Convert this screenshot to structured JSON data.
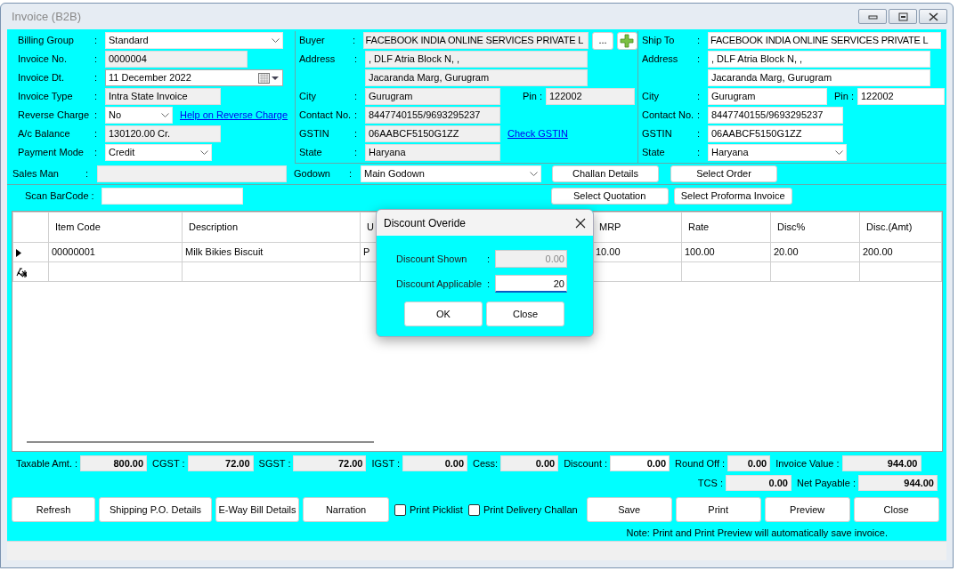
{
  "window": {
    "title": "Invoice (B2B)"
  },
  "invoice": [
    {
      "label": "Billing Group",
      "sep": ":",
      "kind": "select",
      "value": "Standard"
    },
    {
      "label": "Invoice No.",
      "sep": ":",
      "kind": "readonly",
      "value": "0000004"
    },
    {
      "label": "Invoice Dt.",
      "sep": ":",
      "kind": "date",
      "value": "11 December 2022"
    },
    {
      "label": "Invoice Type",
      "sep": ":",
      "kind": "readonly",
      "value": "Intra State Invoice"
    },
    {
      "label": "Reverse Charge",
      "sep": ":",
      "kind": "select",
      "value": "No",
      "link": "Help on Reverse Charge"
    },
    {
      "label": "A/c Balance",
      "sep": ":",
      "kind": "readonly",
      "value": "130120.00 Cr."
    },
    {
      "label": "Payment Mode",
      "sep": ":",
      "kind": "select",
      "value": "Credit"
    }
  ],
  "buyer": [
    {
      "label": "Buyer",
      "sep": ":",
      "kind": "readonly",
      "value": "FACEBOOK INDIA ONLINE SERVICES PRIVATE L",
      "button": "...",
      "add_button": true
    },
    {
      "label": "Address",
      "sep": ":",
      "kind": "readonly",
      "value": ", DLF Atria Block N, ,"
    },
    {
      "kind": "readonly",
      "value": "Jacaranda Marg, Gurugram"
    },
    {
      "label": "City",
      "sep": ":",
      "kind": "readonly",
      "value": "Gurugram",
      "pin_label": "Pin :",
      "pin": "122002"
    },
    {
      "label": "Contact No.",
      "sep": ":",
      "kind": "readonly",
      "value": "8447740155/9693295237"
    },
    {
      "label": "GSTIN",
      "sep": ":",
      "kind": "readonly",
      "value": "06AABCF5150G1ZZ",
      "link": "Check GSTIN"
    },
    {
      "label": "State",
      "sep": ":",
      "kind": "readonly",
      "value": "Haryana"
    }
  ],
  "ship_to": [
    {
      "label": "Ship To",
      "sep": ":",
      "kind": "input",
      "value": "FACEBOOK INDIA ONLINE SERVICES PRIVATE L"
    },
    {
      "label": "Address",
      "sep": ":",
      "kind": "input",
      "value": ", DLF Atria Block N, ,"
    },
    {
      "kind": "input",
      "value": "Jacaranda Marg, Gurugram"
    },
    {
      "label": "City",
      "sep": ":",
      "kind": "input",
      "value": "Gurugram",
      "pin_label": "Pin :",
      "pin": "122002"
    },
    {
      "label": "Contact No.",
      "sep": ":",
      "kind": "input",
      "value": "8447740155/9693295237"
    },
    {
      "label": "GSTIN",
      "sep": ":",
      "kind": "input",
      "value": "06AABCF5150G1ZZ"
    },
    {
      "label": "State",
      "sep": ":",
      "kind": "select",
      "value": "Haryana"
    }
  ],
  "sales_man": {
    "label": "Sales Man",
    "sep": ":",
    "kind": "readonly"
  },
  "godown": {
    "label": "Godown",
    "sep": ":",
    "kind": "select",
    "value": "Main Godown"
  },
  "order_buttons": [
    "Challan Details",
    "Select Order"
  ],
  "scan_barcode": {
    "label": "Scan BarCode :",
    "kind": "input"
  },
  "quote_buttons": [
    "Select Quotation",
    "Select Proforma Invoice"
  ],
  "table": {
    "columns": [
      "Item Code",
      "Description",
      "U",
      "MRP",
      "Rate",
      "Disc%",
      "Disc.(Amt)"
    ],
    "rows": [
      {
        "kind": "current",
        "cells": [
          "00000001",
          "Milk Bikies Biscuit",
          "P",
          "10.00",
          "100.00",
          "20.00",
          "200.00"
        ]
      },
      {
        "kind": "new"
      }
    ]
  },
  "totals": [
    {
      "label": "Taxable Amt. :",
      "value": "800.00",
      "kind": "readonly"
    },
    {
      "label": "CGST :",
      "value": "72.00",
      "kind": "readonly"
    },
    {
      "label": "SGST :",
      "value": "72.00",
      "kind": "readonly"
    },
    {
      "label": "IGST :",
      "value": "0.00",
      "kind": "readonly"
    },
    {
      "label": "Cess:",
      "value": "0.00",
      "kind": "readonly"
    },
    {
      "label": "Discount :",
      "value": "0.00",
      "kind": "input"
    },
    {
      "label": "Round Off :",
      "value": "0.00",
      "kind": "readonly"
    },
    {
      "label": "Invoice Value :",
      "value": "944.00",
      "kind": "readonly"
    }
  ],
  "totals_2": [
    {
      "label": "TCS :",
      "value": "0.00",
      "kind": "readonly"
    },
    {
      "label": "Net Payable  :",
      "value": "944.00",
      "kind": "readonly"
    }
  ],
  "actions": [
    {
      "kind": "button",
      "label": "Refresh"
    },
    {
      "kind": "button",
      "label": "Shipping P.O. Details"
    },
    {
      "kind": "button",
      "label": "E-Way Bill Details"
    },
    {
      "kind": "button",
      "label": "Narration"
    },
    {
      "kind": "checkbox",
      "label": "Print Picklist",
      "checked": false
    },
    {
      "kind": "checkbox",
      "label": "Print Delivery Challan",
      "checked": false
    },
    {
      "kind": "button",
      "label": "Save"
    },
    {
      "kind": "button",
      "label": "Print"
    },
    {
      "kind": "button",
      "label": "Preview"
    },
    {
      "kind": "button",
      "label": "Close"
    }
  ],
  "note": "Note: Print and Print Preview will automatically save invoice.",
  "dialog": {
    "title": "Discount Overide",
    "fields": [
      {
        "label": "Discount Shown",
        "sep": ":",
        "value": "0.00",
        "disabled": true
      },
      {
        "label": "Discount Applicable",
        "sep": ":",
        "value": "20",
        "disabled": false
      }
    ],
    "buttons": [
      "OK",
      "Close"
    ]
  }
}
